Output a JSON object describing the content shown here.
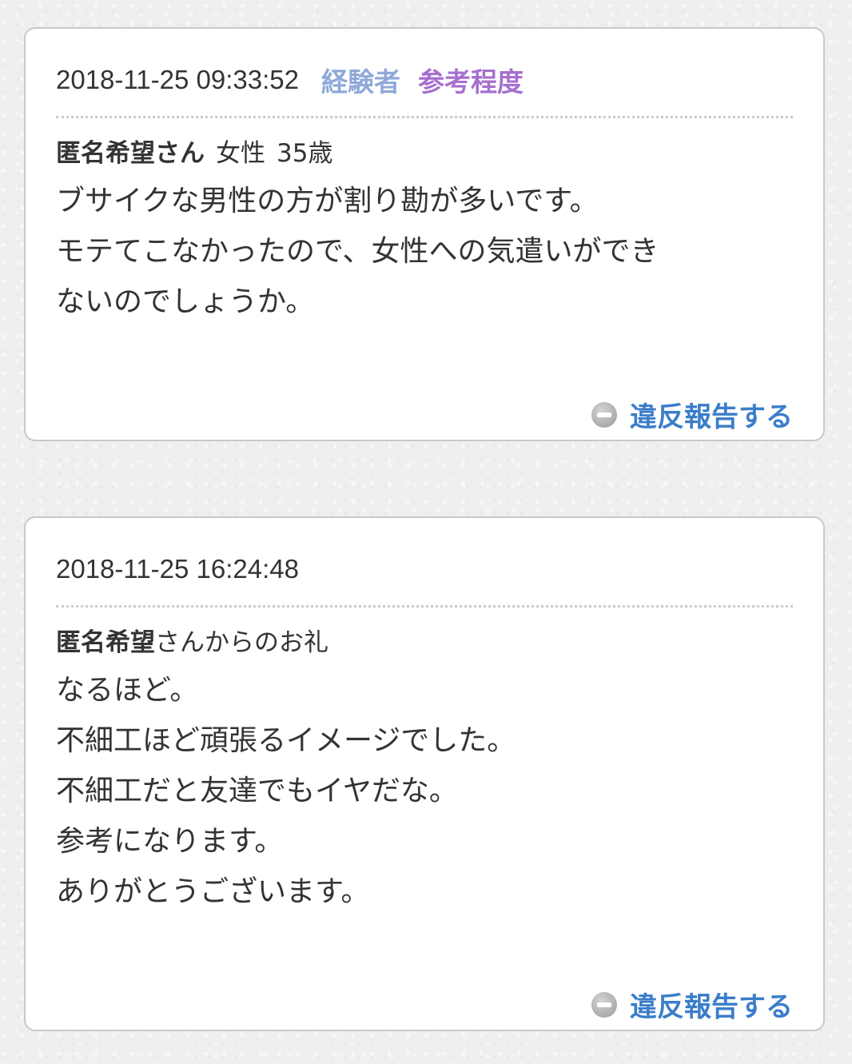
{
  "theme": {
    "tag_experienced_color": "#8fa9d8",
    "tag_reference_color": "#a66fcf",
    "report_link_color": "#3a7dc9"
  },
  "posts": [
    {
      "timestamp": "2018-11-25 09:33:52",
      "tags": [
        "経験者",
        "参考程度"
      ],
      "author_name": "匿名希望さん",
      "author_gender": "女性",
      "author_age": "35歳",
      "body_lines": [
        "ブサイクな男性の方が割り勘が多いです。",
        "モテてこなかったので、女性への気遣いができ",
        "ないのでしょうか。"
      ],
      "report_label": "違反報告する",
      "report_icon": "minus-circle-icon"
    },
    {
      "timestamp": "2018-11-25 16:24:48",
      "author_name": "匿名希望",
      "author_suffix": "さんからのお礼",
      "body_lines": [
        "なるほど。",
        "不細工ほど頑張るイメージでした。",
        "不細工だと友達でもイヤだな。",
        "参考になります。",
        "ありがとうございます。"
      ],
      "report_label": "違反報告する",
      "report_icon": "minus-circle-icon"
    }
  ]
}
